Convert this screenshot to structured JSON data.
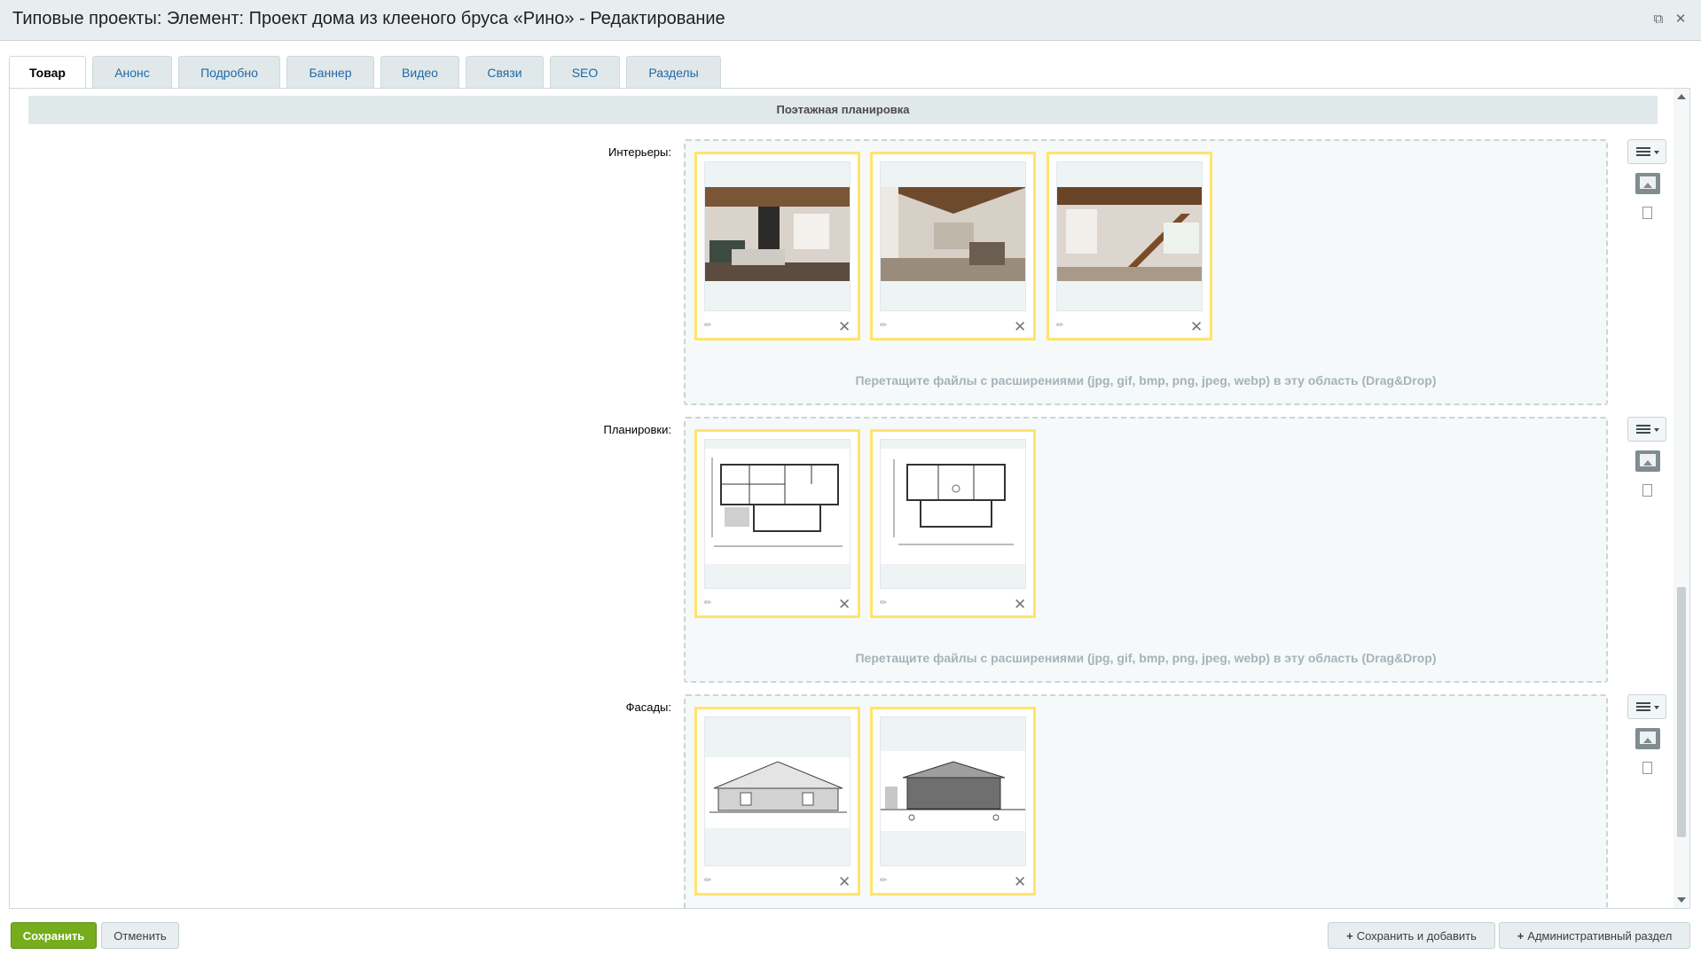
{
  "window": {
    "title": "Типовые проекты: Элемент: Проект дома из клееного бруса «Рино» - Редактирование",
    "restore_icon": "restore-icon",
    "close_icon": "close-icon"
  },
  "tabs": [
    {
      "label": "Товар",
      "active": true
    },
    {
      "label": "Анонс"
    },
    {
      "label": "Подробно"
    },
    {
      "label": "Баннер"
    },
    {
      "label": "Видео"
    },
    {
      "label": "Связи"
    },
    {
      "label": "SEO"
    },
    {
      "label": "Разделы"
    }
  ],
  "section": {
    "heading": "Поэтажная планировка"
  },
  "fields": {
    "interiors": {
      "label": "Интерьеры:",
      "hint": "Перетащите файлы с расширениями (jpg, gif, bmp, png, jpeg, webp) в эту область (Drag&Drop)",
      "files": [
        {
          "kind": "interior-photo-1"
        },
        {
          "kind": "interior-photo-2"
        },
        {
          "kind": "interior-photo-3"
        }
      ]
    },
    "plans": {
      "label": "Планировки:",
      "hint": "Перетащите файлы с расширениями (jpg, gif, bmp, png, jpeg, webp) в эту область (Drag&Drop)",
      "files": [
        {
          "kind": "floor-plan-1"
        },
        {
          "kind": "floor-plan-2"
        }
      ]
    },
    "facades": {
      "label": "Фасады:",
      "files": [
        {
          "kind": "facade-1"
        },
        {
          "kind": "facade-2"
        }
      ]
    }
  },
  "colors": {
    "accent": "#76ad1c",
    "selection": "#ffe46b",
    "tab_link": "#2168a6"
  },
  "footer": {
    "save": "Сохранить",
    "cancel": "Отменить",
    "save_and_add": "Сохранить и добавить",
    "admin_section": "Административный раздел"
  }
}
